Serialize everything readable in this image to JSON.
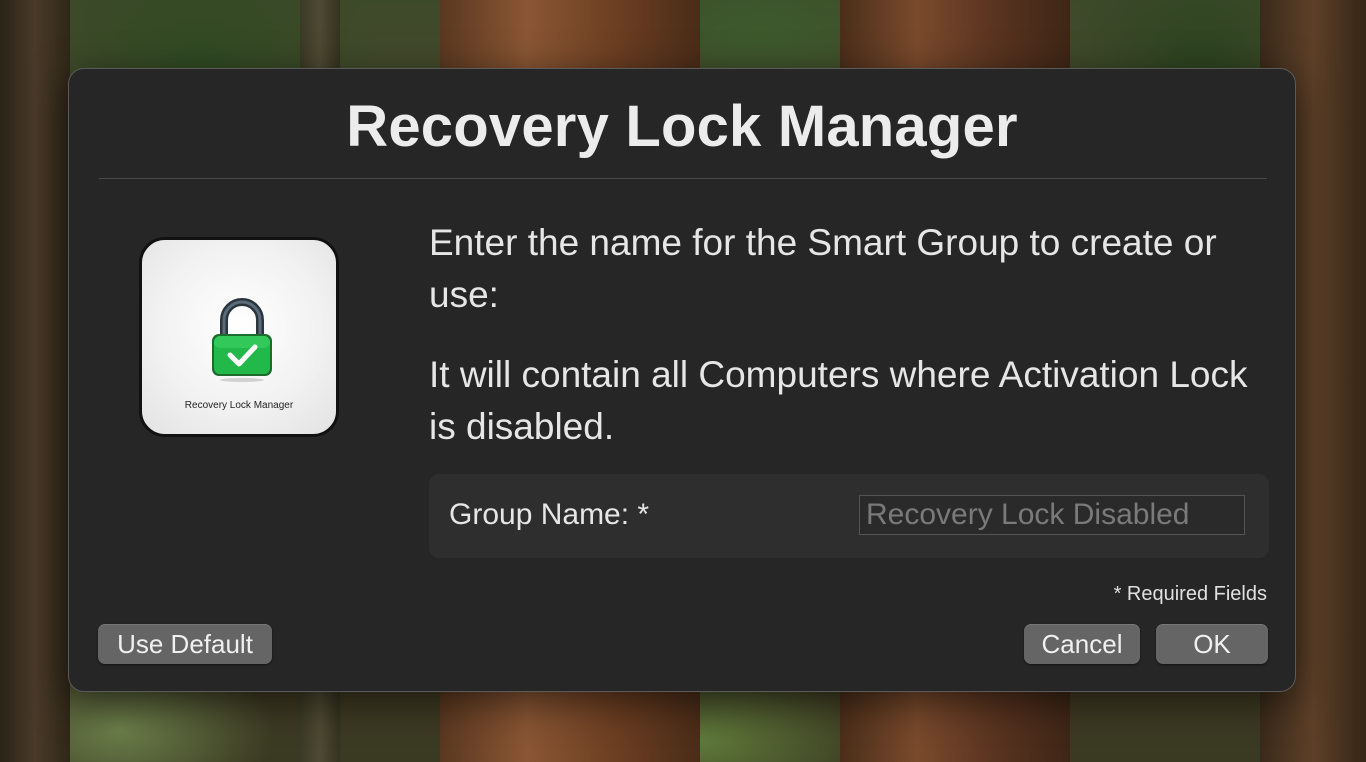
{
  "dialog": {
    "title": "Recovery Lock Manager",
    "icon": {
      "name": "padlock-check-icon",
      "caption": "Recovery Lock Manager",
      "lock_color": "#22b84a",
      "check_color": "#ffffff"
    },
    "message": [
      "Enter the name for the Smart Group to create or use:",
      "It will contain all Computers where Activation Lock is disabled."
    ],
    "field": {
      "label": "Group Name: *",
      "value": "",
      "placeholder": "Recovery Lock Disabled"
    },
    "required_note": "* Required Fields",
    "buttons": {
      "use_default": "Use Default",
      "cancel": "Cancel",
      "ok": "OK"
    }
  },
  "colors": {
    "dialog_bg": "#262626",
    "panel_bg": "#2e2e2e",
    "button_bg": "#656565",
    "text": "#e6e6e6"
  }
}
